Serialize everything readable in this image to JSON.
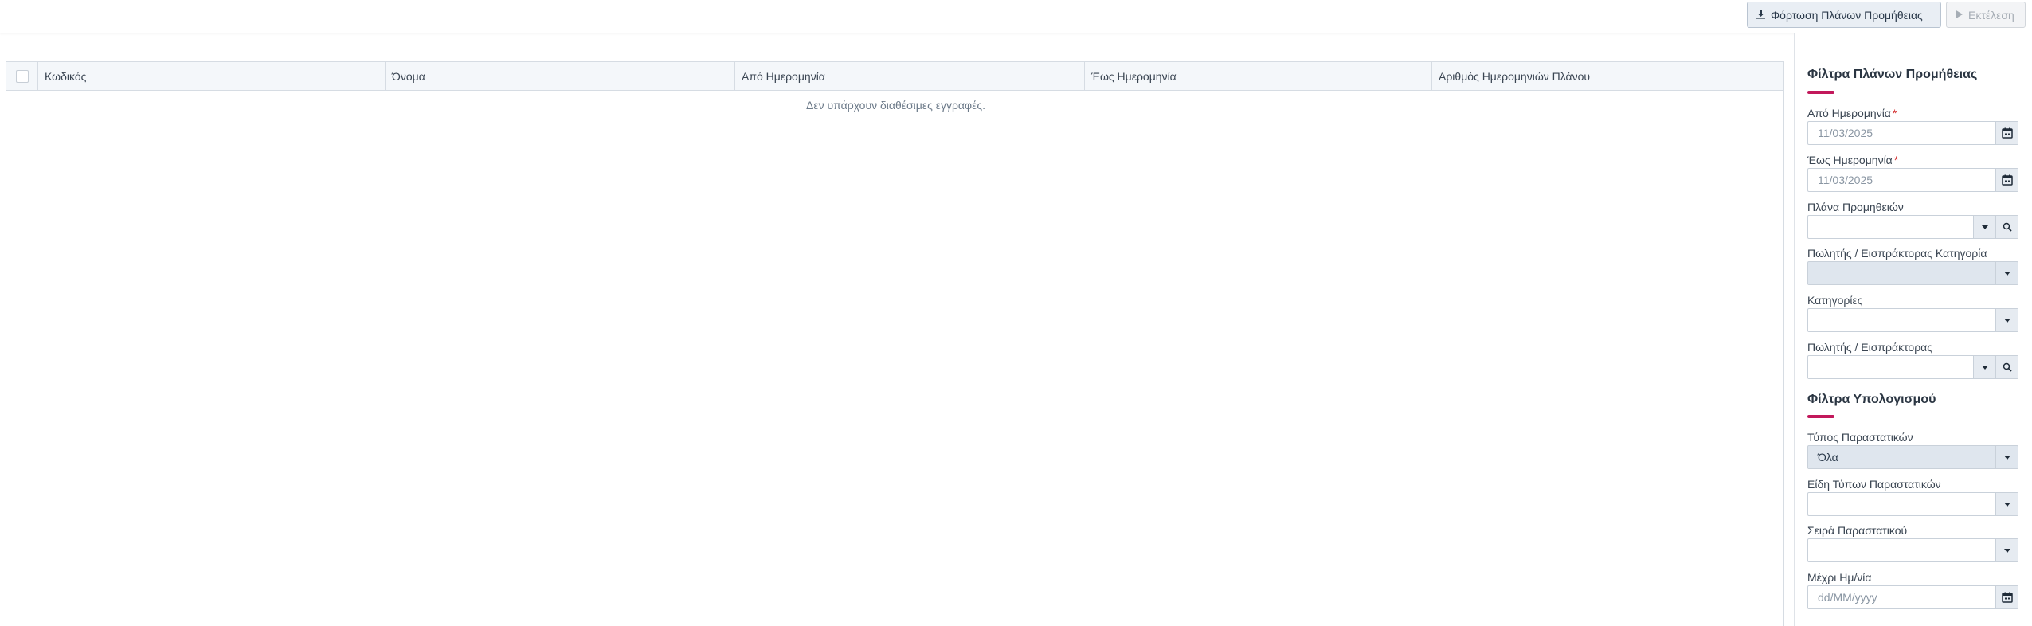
{
  "toolbar": {
    "load_label": "Φόρτωση Πλάνων Προμήθειας",
    "run_label": "Εκτέλεση"
  },
  "grid": {
    "columns": [
      "Κωδικός",
      "Όνομα",
      "Από Ημερομηνία",
      "Έως Ημερομηνία",
      "Αριθμός Ημερομηνιών Πλάνου"
    ],
    "empty_message": "Δεν υπάρχουν διαθέσιμες εγγραφές."
  },
  "filters": {
    "plan_title": "Φίλτρα Πλάνων Προμήθειας",
    "calc_title": "Φίλτρα Υπολογισμού",
    "from_date_label": "Από Ημερομηνία",
    "from_date_value": "11/03/2025",
    "to_date_label": "Έως Ημερομηνία",
    "to_date_value": "11/03/2025",
    "required_mark": "*",
    "plans_label": "Πλάνα Προμηθειών",
    "salesman_category_label": "Πωλητής / Εισπράκτορας Κατηγορία",
    "categories_label": "Κατηγορίες",
    "salesman_label": "Πωλητής / Εισπράκτορας",
    "doc_type_label": "Τύπος Παραστατικών",
    "doc_type_value": "Όλα",
    "doc_kinds_label": "Είδη Τύπων Παραστατικών",
    "doc_series_label": "Σειρά Παραστατικού",
    "until_date_label": "Μέχρι Ημ/νία",
    "until_date_placeholder": "dd/MM/yyyy"
  },
  "icons": {
    "load": "download-icon",
    "run": "play-icon",
    "calendar": "calendar-icon",
    "dropdown": "caret-down-icon",
    "search": "search-icon"
  },
  "colors": {
    "accent_bar": "#c2185b",
    "required": "#d32f2f"
  }
}
